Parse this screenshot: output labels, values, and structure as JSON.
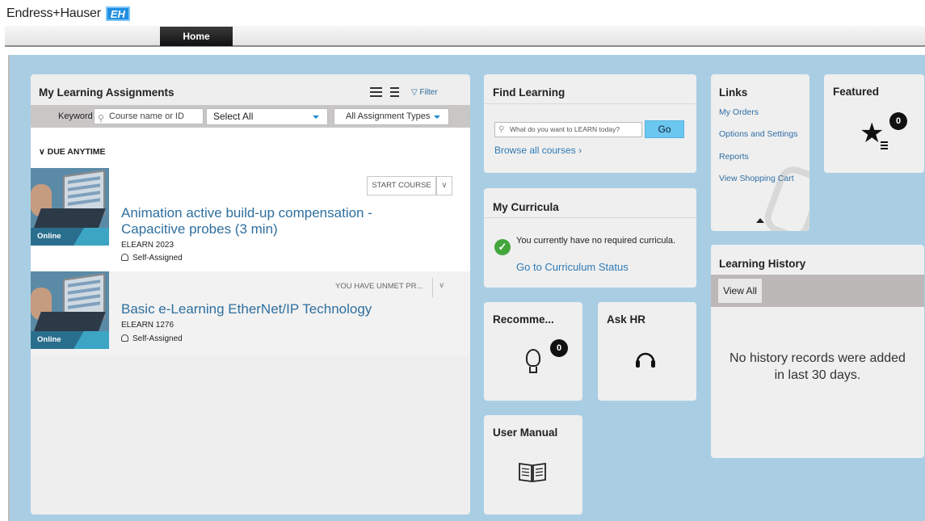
{
  "header": {
    "brand": "Endress+Hauser",
    "brand_mark": "EH",
    "nav_tabs": [
      {
        "label": "Home",
        "active": true
      }
    ]
  },
  "assignments": {
    "title": "My Learning Assignments",
    "filter_label": "Filter",
    "keyword_label": "Keyword",
    "keyword_placeholder": "Course name or ID",
    "select_all": "Select All",
    "assignment_types": "All Assignment Types",
    "due_heading": "DUE ANYTIME",
    "courses": [
      {
        "title_line1": "Animation active build-up compensation -",
        "title_line2": "Capacitive probes (3 min)",
        "code": "ELEARN 2023",
        "assigned": "Self-Assigned",
        "badge": "Online",
        "action": "START COURSE"
      },
      {
        "title_line1": "Basic e-Learning EtherNet/IP Technology",
        "code": "ELEARN 1276",
        "assigned": "Self-Assigned",
        "badge": "Online",
        "action": "YOU HAVE UNMET PR..."
      }
    ]
  },
  "find_learning": {
    "title": "Find Learning",
    "search_placeholder": "What do you want to LEARN today?",
    "go_label": "Go",
    "browse_label": "Browse all courses"
  },
  "curricula": {
    "title": "My Curricula",
    "message": "You currently have no required curricula.",
    "link": "Go to Curriculum Status"
  },
  "recommended": {
    "title": "Recomme...",
    "count": "0"
  },
  "ask_hr": {
    "title": "Ask HR"
  },
  "user_manual": {
    "title": "User Manual"
  },
  "links": {
    "title": "Links",
    "items": [
      "My Orders",
      "Options and Settings",
      "Reports",
      "View Shopping Cart"
    ]
  },
  "featured": {
    "title": "Featured",
    "count": "0"
  },
  "history": {
    "title": "Learning History",
    "view_all": "View All",
    "empty_message": "No history records were added in last 30 days."
  },
  "colors": {
    "background": "#a9cee4",
    "link": "#2f6f9e",
    "go_button": "#6cc7f0",
    "success": "#43a63c"
  }
}
